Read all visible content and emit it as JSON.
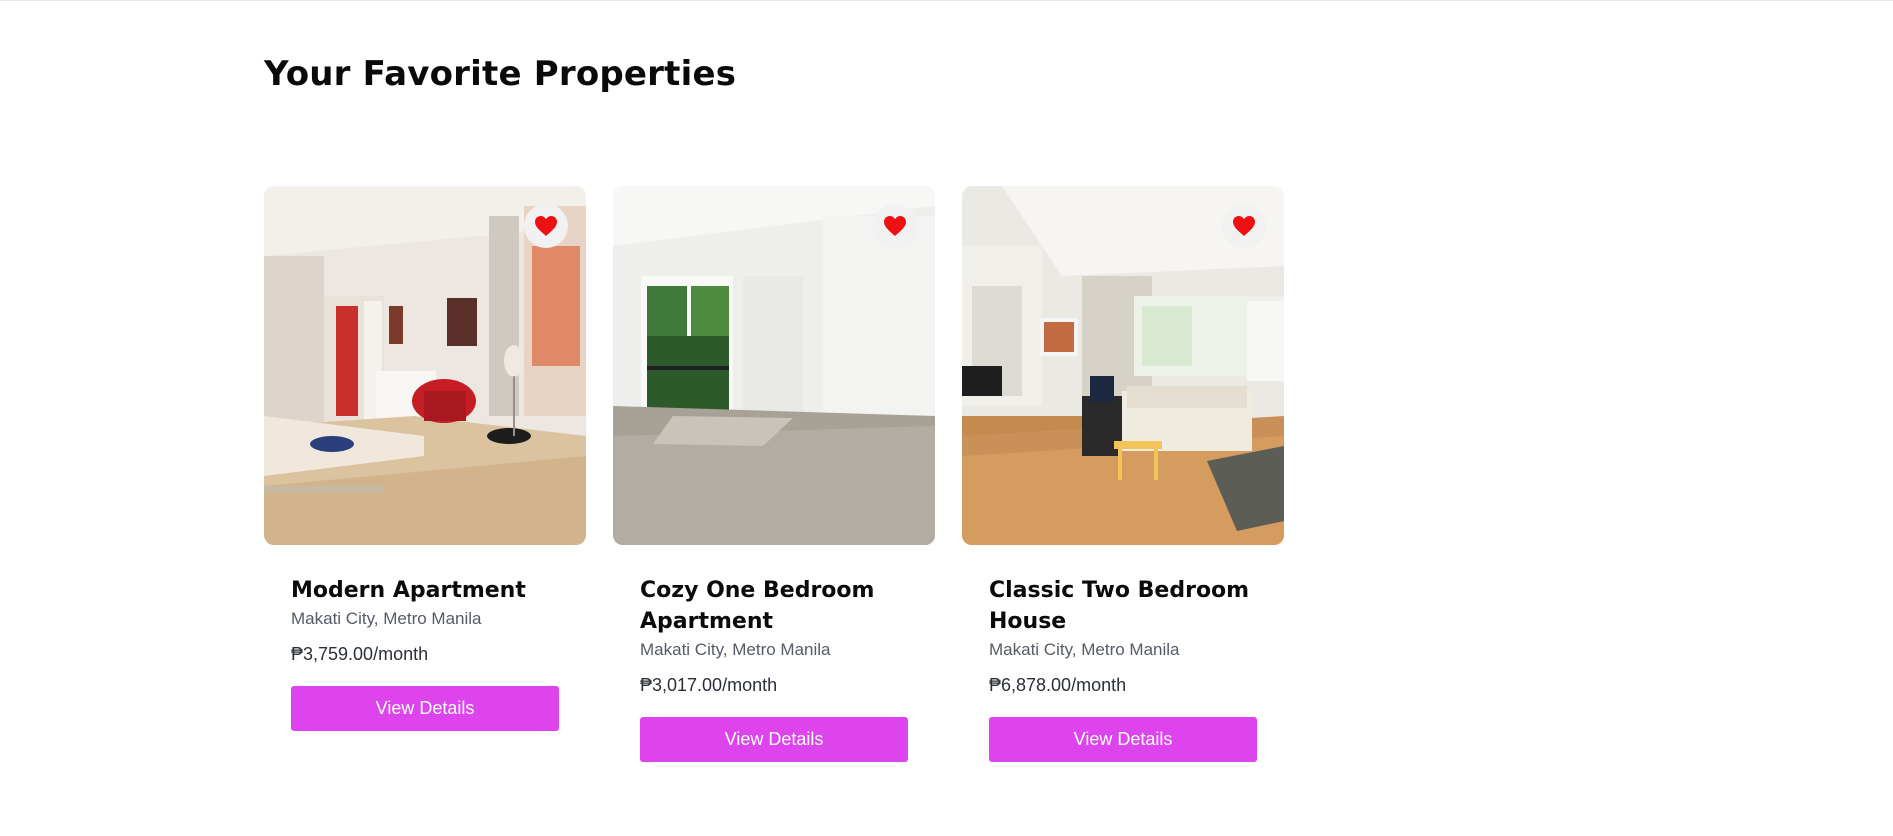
{
  "page": {
    "title": "Your Favorite Properties"
  },
  "colors": {
    "accent": "#dd44ee",
    "heart": "#ee1111"
  },
  "properties": [
    {
      "name": "Modern Apartment",
      "location": "Makati City, Metro Manila",
      "price": "₱3,759.00/month",
      "button_label": "View Details",
      "favorite_icon": "heart-icon"
    },
    {
      "name": "Cozy One Bedroom Apartment",
      "location": "Makati City, Metro Manila",
      "price": "₱3,017.00/month",
      "button_label": "View Details",
      "favorite_icon": "heart-icon"
    },
    {
      "name": "Classic Two Bedroom House",
      "location": "Makati City, Metro Manila",
      "price": "₱6,878.00/month",
      "button_label": "View Details",
      "favorite_icon": "heart-icon"
    }
  ]
}
